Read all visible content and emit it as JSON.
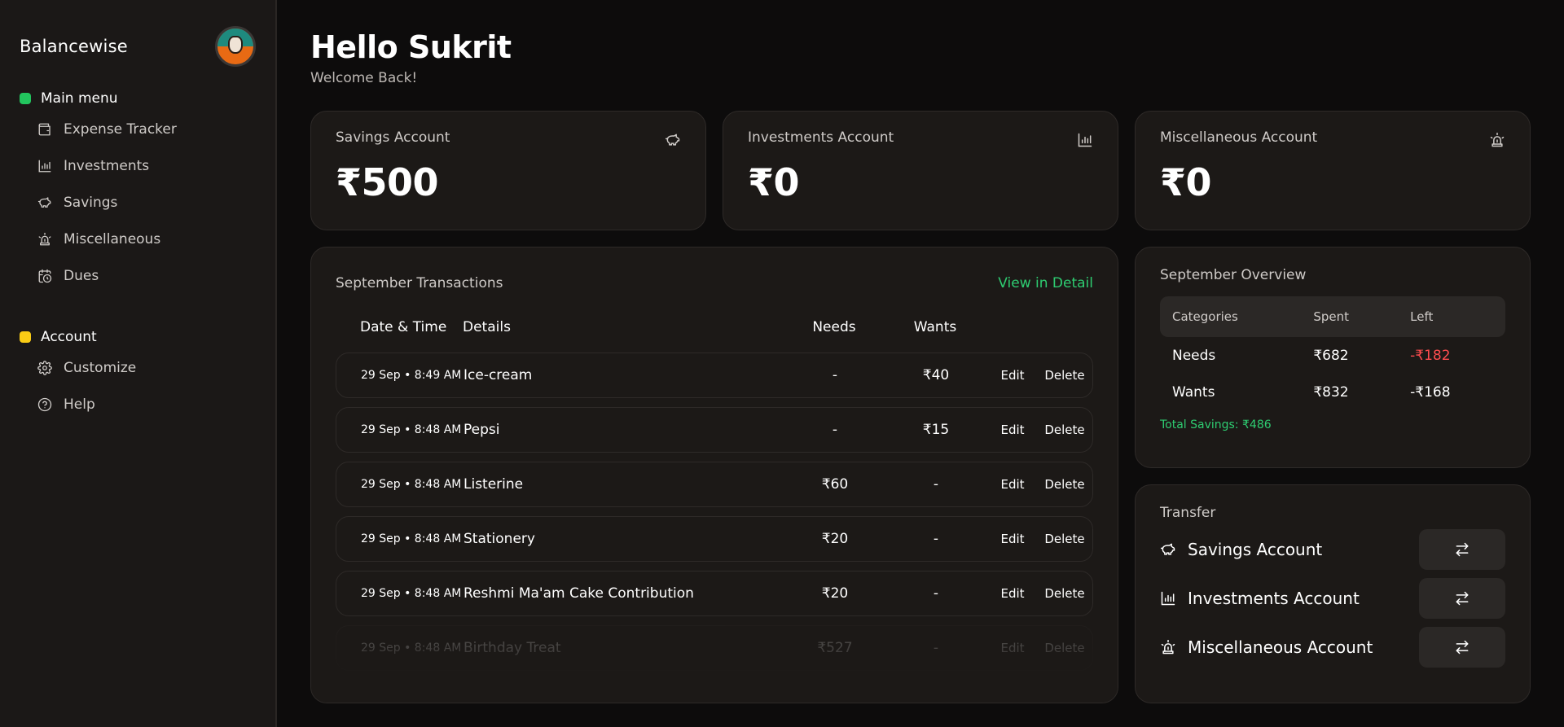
{
  "app": {
    "brand": "Balancewise"
  },
  "sidebar": {
    "main_menu": {
      "label": "Main menu",
      "dot_color": "#22c55e",
      "items": [
        {
          "label": "Expense Tracker",
          "icon": "wallet-icon"
        },
        {
          "label": "Investments",
          "icon": "bar-chart-icon"
        },
        {
          "label": "Savings",
          "icon": "piggy-bank-icon"
        },
        {
          "label": "Miscellaneous",
          "icon": "siren-icon"
        },
        {
          "label": "Dues",
          "icon": "calendar-clock-icon"
        }
      ]
    },
    "account": {
      "label": "Account",
      "dot_color": "#facc15",
      "items": [
        {
          "label": "Customize",
          "icon": "gear-icon"
        },
        {
          "label": "Help",
          "icon": "help-circle-icon"
        }
      ]
    }
  },
  "header": {
    "title": "Hello Sukrit",
    "subtitle": "Welcome Back!"
  },
  "accounts": [
    {
      "title": "Savings Account",
      "amount": "₹500",
      "icon": "piggy-bank-icon"
    },
    {
      "title": "Investments Account",
      "amount": "₹0",
      "icon": "bar-chart-icon"
    },
    {
      "title": "Miscellaneous Account",
      "amount": "₹0",
      "icon": "siren-icon"
    }
  ],
  "transactions": {
    "title": "September Transactions",
    "link": "View in Detail",
    "columns": {
      "date": "Date & Time",
      "details": "Details",
      "needs": "Needs",
      "wants": "Wants"
    },
    "edit_label": "Edit",
    "delete_label": "Delete",
    "rows": [
      {
        "date": "29 Sep • 8:49 AM",
        "details": "Ice-cream",
        "needs": "-",
        "wants": "₹40"
      },
      {
        "date": "29 Sep • 8:48 AM",
        "details": "Pepsi",
        "needs": "-",
        "wants": "₹15"
      },
      {
        "date": "29 Sep • 8:48 AM",
        "details": "Listerine",
        "needs": "₹60",
        "wants": "-"
      },
      {
        "date": "29 Sep • 8:48 AM",
        "details": "Stationery",
        "needs": "₹20",
        "wants": "-"
      },
      {
        "date": "29 Sep • 8:48 AM",
        "details": "Reshmi Ma'am Cake Contribution",
        "needs": "₹20",
        "wants": "-"
      },
      {
        "date": "29 Sep • 8:48 AM",
        "details": "Birthday Treat",
        "needs": "₹527",
        "wants": "-"
      }
    ]
  },
  "overview": {
    "title": "September Overview",
    "headers": {
      "categories": "Categories",
      "spent": "Spent",
      "left": "Left"
    },
    "rows": [
      {
        "category": "Needs",
        "spent": "₹682",
        "left": "-₹182"
      },
      {
        "category": "Wants",
        "spent": "₹832",
        "left": "-₹168"
      }
    ],
    "total_savings": "Total Savings: ₹486",
    "negative_color": "#ff4d4f",
    "positive_color": "#2ecc71"
  },
  "transfer": {
    "title": "Transfer",
    "items": [
      {
        "label": "Savings Account",
        "icon": "piggy-bank-icon",
        "button_icon": "transfer-arrows-icon"
      },
      {
        "label": "Investments Account",
        "icon": "bar-chart-icon",
        "button_icon": "transfer-arrows-icon"
      },
      {
        "label": "Miscellaneous Account",
        "icon": "siren-icon",
        "button_icon": "transfer-arrows-icon"
      }
    ]
  }
}
